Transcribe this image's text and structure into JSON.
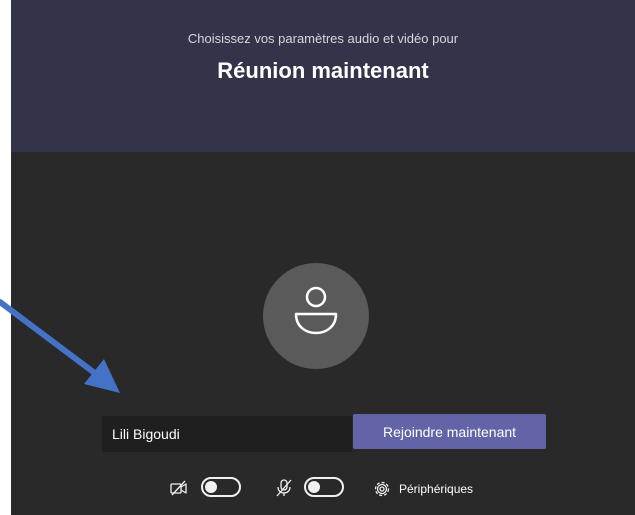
{
  "header": {
    "subtitle": "Choisissez vos paramètres audio et vidéo pour",
    "title": "Réunion maintenant"
  },
  "join_form": {
    "name_value": "Lili Bigoudi",
    "join_label": "Rejoindre maintenant"
  },
  "controls": {
    "camera": {
      "icon": "camera-off-icon",
      "enabled": false
    },
    "microphone": {
      "icon": "microphone-off-icon",
      "enabled": false
    },
    "devices": {
      "icon": "gear-icon",
      "label": "Périphériques"
    }
  },
  "colors": {
    "header_bg": "#33344a",
    "body_bg": "#292929",
    "accent": "#6264a7",
    "annotation_arrow": "#4472c4"
  }
}
